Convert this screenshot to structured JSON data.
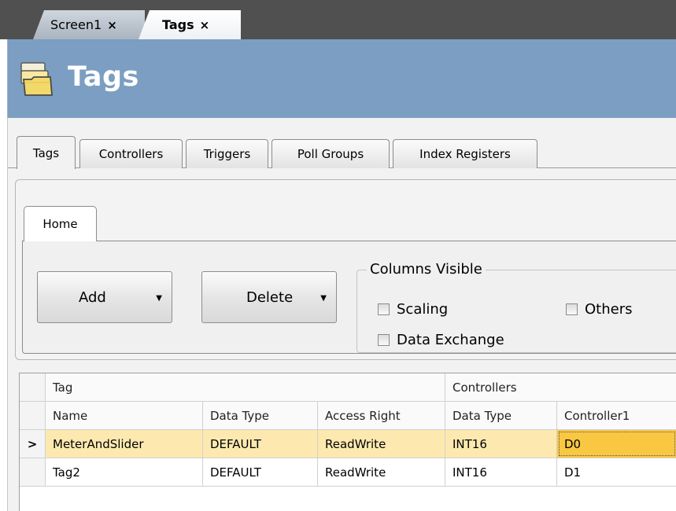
{
  "doc_tabs": [
    {
      "label": "Screen1",
      "close": "×"
    },
    {
      "label": "Tags",
      "close": "×"
    }
  ],
  "header": {
    "title": "Tags"
  },
  "view_tabs": [
    "Tags",
    "Controllers",
    "Triggers",
    "Poll Groups",
    "Index Registers"
  ],
  "ribbon": {
    "tab": "Home",
    "add_label": "Add",
    "delete_label": "Delete",
    "columns_visible": {
      "legend": "Columns Visible",
      "scaling": "Scaling",
      "others": "Others",
      "data_exchange": "Data Exchange"
    }
  },
  "grid": {
    "group_headers": {
      "tag": "Tag",
      "controllers": "Controllers"
    },
    "columns": [
      "Name",
      "Data Type",
      "Access Right",
      "Data Type",
      "Controller1"
    ],
    "row_indicator": ">",
    "rows": [
      [
        "MeterAndSlider",
        "DEFAULT",
        "ReadWrite",
        "INT16",
        "D0"
      ],
      [
        "Tag2",
        "DEFAULT",
        "ReadWrite",
        "INT16",
        "D1"
      ]
    ]
  },
  "colors": {
    "header_bg": "#7b9ec2",
    "selected_row": "#fde9b0",
    "focus_cell": "#fac743"
  }
}
